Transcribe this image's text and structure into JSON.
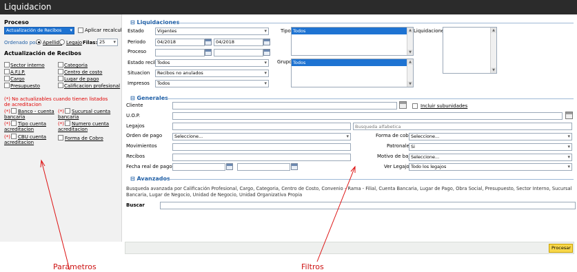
{
  "window": {
    "title": "Liquidacion"
  },
  "left": {
    "proceso_label": "Proceso",
    "proceso_value": "Actualización de Recibos",
    "aplicar_recalculo": "Aplicar recalculo",
    "ordenado_por": "Ordenado por",
    "apellido": "Apellido",
    "legajo": "Legajo",
    "filas_label": "Filas:",
    "filas_value": "25",
    "actualizacion_title": "Actualización de Recibos",
    "items_left": [
      "Sector interno",
      "A.F.J.P.",
      "Cargo",
      "Presupuesto"
    ],
    "items_right": [
      "Categoria",
      "Centro de costo",
      "Lugar de pago",
      "Calificacion profesional"
    ],
    "warning": "(*) No actualizables cuando tienen listados de acreditacion",
    "star": "(*)",
    "acc_left_1a": "Banco - cuenta",
    "acc_left_1b": "bancaria",
    "acc_right_1a": "Sucursal cuenta",
    "acc_right_1b": "bancaria",
    "acc_left_2a": "Tipo cuenta",
    "acc_left_2b": "acreditacion",
    "acc_right_2a": "Numero cuenta",
    "acc_right_2b": "acreditacion",
    "acc_left_3a": "CBU cuenta",
    "acc_left_3b": "acreditacion",
    "forma_cobro": "Forma de Cobro"
  },
  "liquidaciones": {
    "title": "Liquidaciones",
    "estado_label": "Estado",
    "estado_value": "Vigentes",
    "periodo_label": "Periodo",
    "periodo_from": "04/2018",
    "periodo_to": "04/2018",
    "proceso_label": "Proceso",
    "estado_recibo_label": "Estado recibo",
    "estado_recibo_value": "Todos",
    "situacion_label": "Situacion",
    "situacion_value": "Recibos no anulados",
    "impresos_label": "Impresos",
    "impresos_value": "Todos",
    "tipo_label": "Tipo",
    "tipo_value": "Todos",
    "grupo_label": "Grupo",
    "grupo_value": "Todos",
    "liquidaciones_label": "Liquidaciones"
  },
  "generales": {
    "title": "Generales",
    "cliente": "Cliente",
    "incluir_subunidades": "Incluir subunidades",
    "uop": "U.O.P.",
    "legajos": "Legajos",
    "busqueda_placeholder": "Busqueda alfabetica",
    "orden_pago": "Orden de pago",
    "orden_pago_value": "Seleccione...",
    "movimientos": "Movimientos",
    "recibos": "Recibos",
    "fecha_real_pago": "Fecha real de pago",
    "forma_cobro": "Forma de cobro",
    "forma_cobro_value": "Seleccione...",
    "patronales": "Patronales",
    "patronales_value": "Si",
    "motivo_baja": "Motivo de baja",
    "motivo_baja_value": "Seleccione...",
    "ver_legajos": "Ver Legajos",
    "ver_legajos_value": "Todo los legajos"
  },
  "avanzados": {
    "title": "Avanzados",
    "description": "Busqueda avanzada por Calificación Profesional, Cargo, Categoria, Centro de Costo, Convenio - Rama - Filial, Cuenta Bancaria, Lugar de Pago, Obra Social, Presupuesto, Sector Interno, Sucursal Bancaria, Lugar de Negocio, Unidad de Negocio, Unidad Organizativa Propia",
    "buscar": "Buscar"
  },
  "procesar": "Procesar",
  "annotations": {
    "parametros": "Parámetros",
    "filtros": "Filtros"
  },
  "colors": {
    "accent": "#1f5fa6",
    "selection": "#1e73d2",
    "titlebar": "#2b2b2b",
    "required": "#e00000",
    "button": "#f8d74a"
  }
}
